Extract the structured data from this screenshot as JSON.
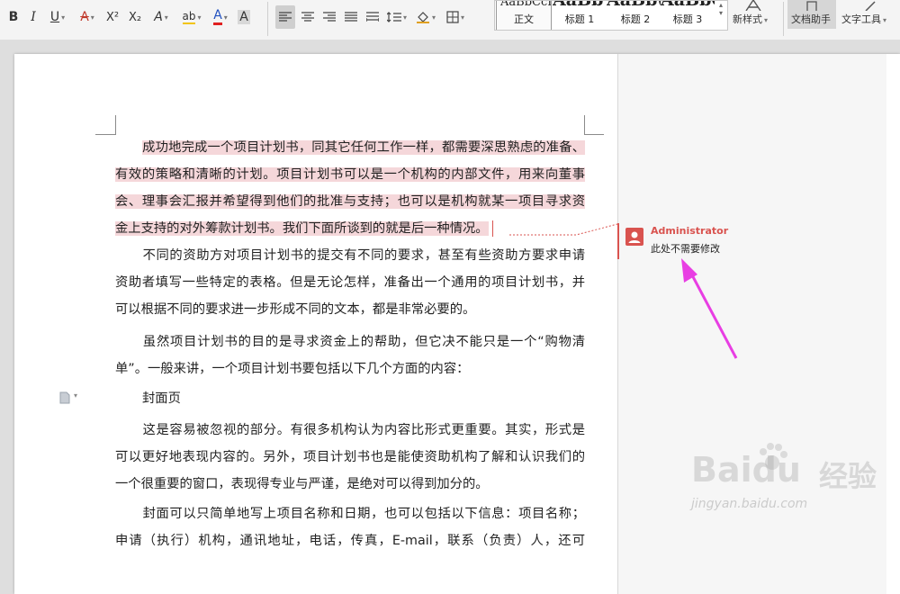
{
  "toolbar": {
    "bold": "B",
    "italic": "I",
    "underline": "U",
    "strikethrough": "A",
    "superscript": "X²",
    "subscript": "X₂",
    "text_effect": "A",
    "char_highlight": "ab",
    "font_color": "A",
    "char_shading": "A",
    "styles": [
      {
        "preview": "AaBbCcI",
        "label": "正文"
      },
      {
        "preview": "AaBb",
        "label": "标题 1"
      },
      {
        "preview": "AaBb(",
        "label": "标题 2"
      },
      {
        "preview": "AaBbC",
        "label": "标题 3"
      }
    ],
    "new_style_label": "新样式",
    "doc_helper_label": "文档助手",
    "text_tools_label": "文字工具"
  },
  "document": {
    "paragraphs": [
      [
        "成功地完成一个项目计划书，同其它任何工作一样，都需要深思熟虑的准备、",
        "有效的策略和清晰的计划。项目计划书可以是一个机构的内部文件，用来向董事",
        "会、理事会汇报并希望得到他们的批准与支持；也可以是机构就某一项目寻求资",
        "金上支持的对外筹款计划书。我们下面所谈到的就是后一种情况。"
      ],
      [
        "不同的资助方对项目计划书的提交有不同的要求，甚至有些资助方要求申请",
        "资助者填写一些特定的表格。但是无论怎样，准备出一个通用的项目计划书，并",
        "可以根据不同的要求进一步形成不同的文本，都是非常必要的。"
      ],
      [
        "虽然项目计划书的目的是寻求资金上的帮助，但它决不能只是一个“购物清",
        "单”。一般来讲，一个项目计划书要包括以下几个方面的内容："
      ],
      [
        "封面页"
      ],
      [
        "这是容易被忽视的部分。有很多机构认为内容比形式更重要。其实，形式是",
        "可以更好地表现内容的。另外，项目计划书也是能使资助机构了解和认识我们的",
        "一个很重要的窗口，表现得专业与严谨，是绝对可以得到加分的。"
      ],
      [
        "封面可以只简单地写上项目名称和日期，也可以包括以下信息：项目名称；",
        "申请（执行）机构，通讯地址，电话，传真，E-mail，联系（负责）人，还可"
      ]
    ]
  },
  "comment": {
    "author": "Administrator",
    "text": "此处不需要修改",
    "color": "#d9534f"
  },
  "highlight_color": "#f5d7da",
  "arrow_color": "#e83ee3",
  "watermark": {
    "brand": "Baidu",
    "product": "经验",
    "url": "jingyan.baidu.com"
  }
}
